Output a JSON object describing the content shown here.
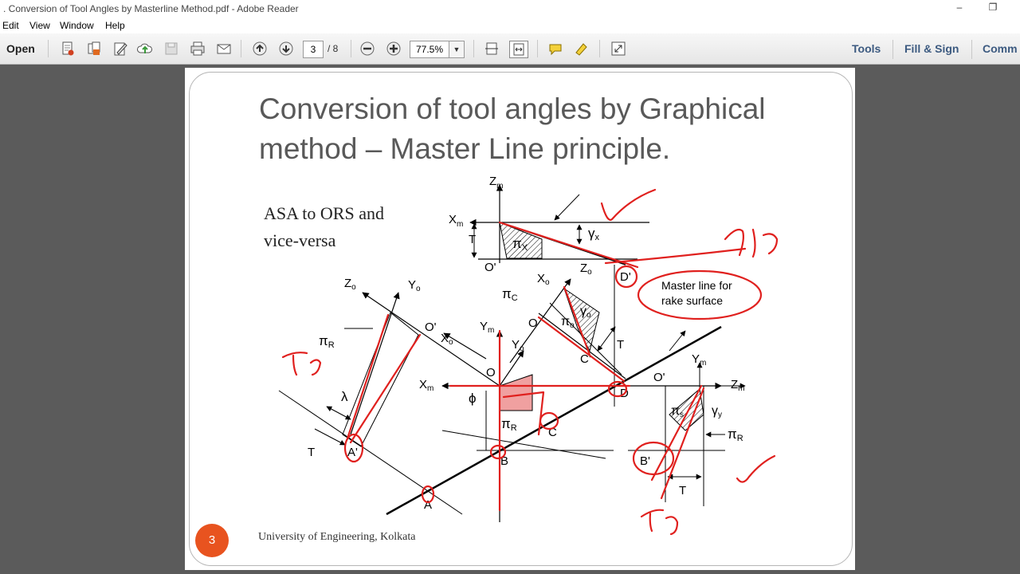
{
  "window": {
    "title": ". Conversion of Tool Angles by Masterline Method.pdf - Adobe Reader",
    "minimize_glyph": "–",
    "restore_glyph": "❐"
  },
  "menu": [
    "Edit",
    "View",
    "Window",
    "Help"
  ],
  "toolbar": {
    "open_label": "Open",
    "icons": [
      "create-pdf-icon",
      "combine-icon",
      "edit-icon",
      "cloud-upload-icon",
      "save-icon",
      "print-icon",
      "email-icon",
      "previous-page-icon",
      "next-page-icon",
      "zoom-out-icon",
      "zoom-in-icon",
      "fit-page-icon",
      "fit-width-icon",
      "comment-icon",
      "highlight-icon",
      "fullscreen-icon"
    ],
    "current_page": "3",
    "total_pages": "/ 8",
    "zoom": "77.5%",
    "right_links": [
      "Tools",
      "Fill & Sign",
      "Comm"
    ]
  },
  "slide": {
    "title": "Conversion of tool angles by Graphical method – Master Line principle.",
    "subtitle_line1": "ASA to ORS and",
    "subtitle_line2": "vice-versa",
    "footer": "University of Engineering, Kolkata",
    "page_number": "3"
  },
  "diagram": {
    "labels": {
      "zm": "Z",
      "zm_sub": "m",
      "xm_top": "X",
      "xm_top_sub": "m",
      "t_top": "T",
      "pix": "π",
      "pix_sub": "X",
      "gammax": "γ",
      "gammax_sub": "x",
      "o_prime_top": "O'",
      "zo_top": "Z",
      "zo_top_sub": "o",
      "d_prime": "D'",
      "master_line_1": "Master line for",
      "master_line_2": "rake surface",
      "pic": "π",
      "pic_sub": "C",
      "xo_mid": "X",
      "xo_mid_sub": "o",
      "o_mid": "O",
      "pio": "π",
      "pio_sub": "o",
      "gammao": "γ",
      "gammao_sub": "o",
      "t_mid": "T",
      "c_prime": "C'",
      "zo_left": "Z",
      "zo_left_sub": "o",
      "yo_left": "Y",
      "yo_left_sub": "o",
      "o_prime_left": "O'",
      "xo_left": "X",
      "xo_left_sub": "o",
      "pir_left": "π",
      "pir_left_sub": "R",
      "ym_mid": "Y",
      "ym_mid_sub": "m",
      "yo_mid": "Y",
      "yo_mid_sub": "o",
      "o_center": "O",
      "xm_mid": "X",
      "xm_mid_sub": "m",
      "phi": "ϕ",
      "pir_center": "π",
      "pir_center_sub": "R",
      "lambda": "λ",
      "t_left": "T",
      "a_prime": "A'",
      "a": "A",
      "b": "B",
      "c": "C",
      "d": "D",
      "o_prime_right": "O'",
      "ym_right": "Y",
      "ym_right_sub": "m",
      "zm_right": "Z",
      "zm_right_sub": "m",
      "pis_right": "π",
      "pis_right_sub": "s",
      "gammay": "γ",
      "gammay_sub": "y",
      "pir_right": "π",
      "pir_right_sub": "R",
      "b_prime": "B'",
      "t_right": "T"
    },
    "handwritten": {
      "pi_r_top": "π r",
      "pi_c_left": "π c",
      "pi_r_bottom": "π r"
    }
  },
  "colors": {
    "annotation_red": "#e0201e",
    "page_badge": "#e8531f",
    "title_gray": "#595959",
    "toolbar_link": "#3c5a80"
  }
}
